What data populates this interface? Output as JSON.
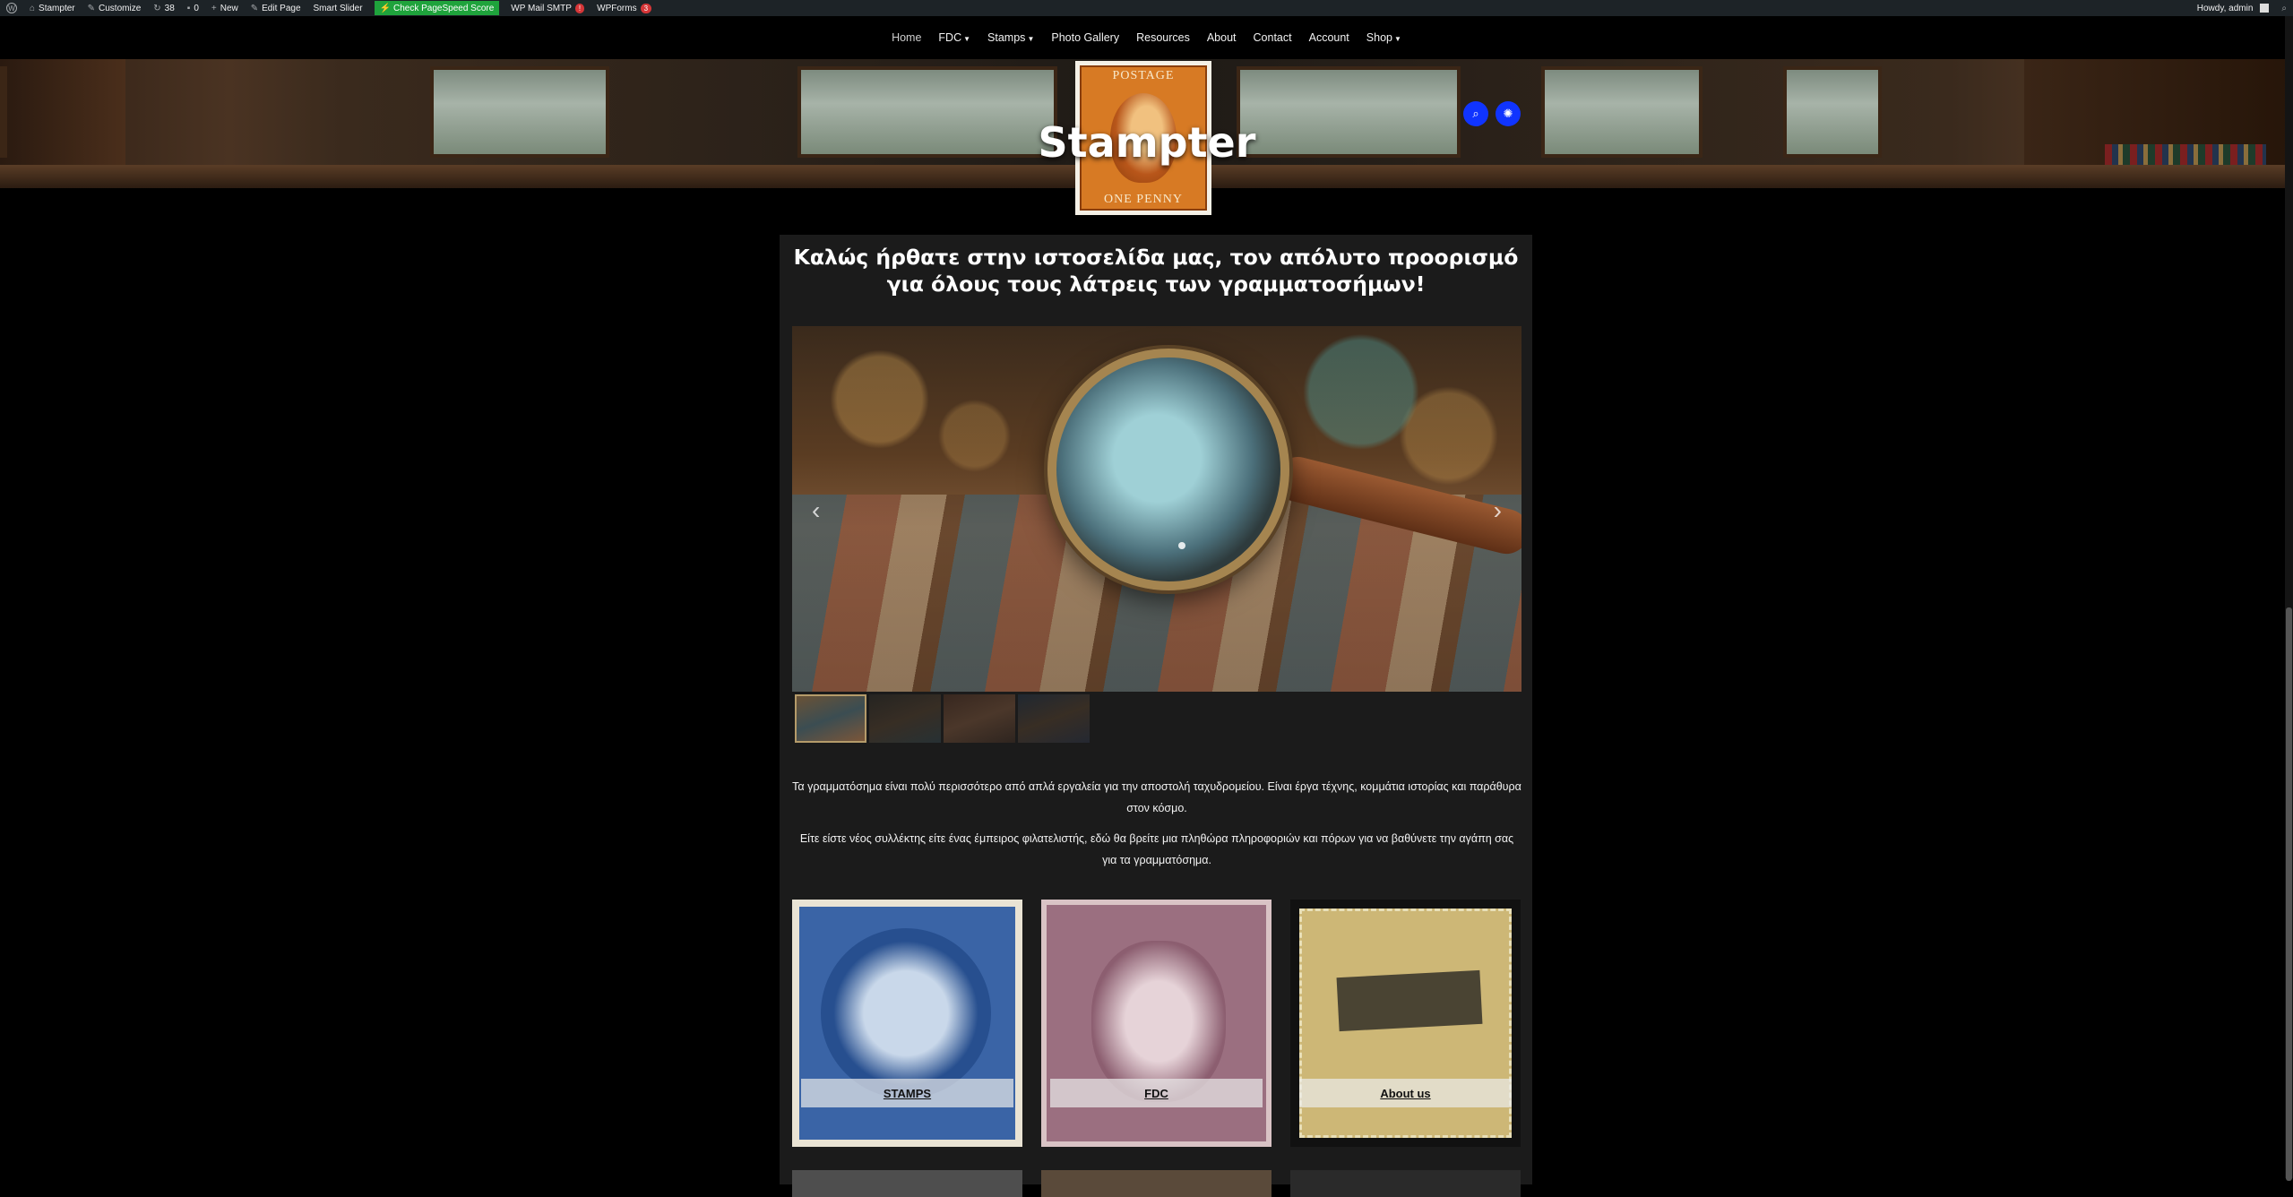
{
  "admin_bar": {
    "site_name": "Stampter",
    "customize": "Customize",
    "updates_count": "38",
    "comments_count": "0",
    "new_label": "New",
    "edit_page": "Edit Page",
    "smart_slider": "Smart Slider",
    "pagespeed": "Check PageSpeed Score",
    "wp_mail_smtp": "WP Mail SMTP",
    "wp_mail_smtp_badge": "!",
    "wpforms": "WPForms",
    "wpforms_badge": "3",
    "howdy": "Howdy, admin"
  },
  "nav": {
    "items": [
      {
        "label": "Home"
      },
      {
        "label": "FDC"
      },
      {
        "label": "Stamps"
      },
      {
        "label": "Photo Gallery"
      },
      {
        "label": "Resources"
      },
      {
        "label": "About"
      },
      {
        "label": "Contact"
      },
      {
        "label": "Account"
      },
      {
        "label": "Shop"
      }
    ]
  },
  "header": {
    "site_title": "Stampter",
    "logo_top_text": "POSTAGE",
    "logo_bottom_text": "ONE PENNY",
    "accent_color": "#1034ff"
  },
  "content": {
    "welcome": "Καλώς ήρθατε στην ιστοσελίδα μας, τον απόλυτο προορισμό για όλους τους λάτρεις των γραμματοσήμων!",
    "paragraph1": "Τα γραμματόσημα είναι πολύ περισσότερο από απλά εργαλεία για την αποστολή ταχυδρομείου. Είναι έργα τέχνης, κομμάτια ιστορίας και παράθυρα στον κόσμο.",
    "paragraph2": "Είτε είστε νέος συλλέκτης είτε ένας έμπειρος φιλατελιστής, εδώ θα βρείτε μια πληθώρα πληροφοριών και πόρων για να βαθύνετε την αγάπη σας για τα γραμματόσημα.",
    "cards": [
      {
        "label": "STAMPS"
      },
      {
        "label": "FDC"
      },
      {
        "label": "About us"
      }
    ]
  },
  "slider": {
    "prev_glyph": "‹",
    "next_glyph": "›"
  }
}
